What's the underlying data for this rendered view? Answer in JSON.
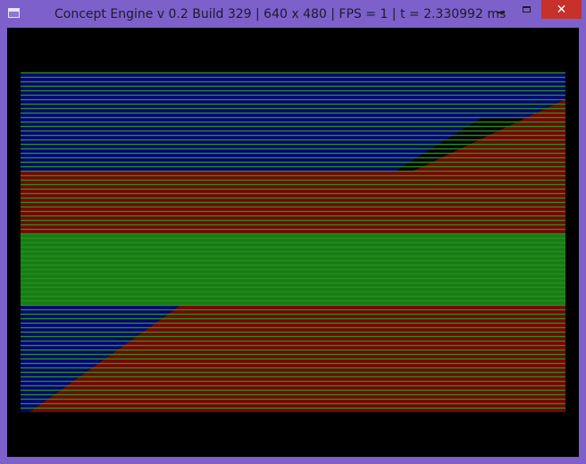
{
  "window": {
    "title": "Concept Engine v 0.2 Build 329 | 640 x 480 | FPS = 1 | t = 2.330992 ms",
    "icon": "app-window-icon",
    "controls": {
      "minimize_icon": "minimize-icon",
      "maximize_icon": "maximize-icon",
      "close_label": "✕"
    }
  },
  "render": {
    "background": "#000000",
    "colors": {
      "blue": "#00007b",
      "red": "#7b0000",
      "green": "#147d14",
      "line_green": "#2a8a20"
    }
  }
}
